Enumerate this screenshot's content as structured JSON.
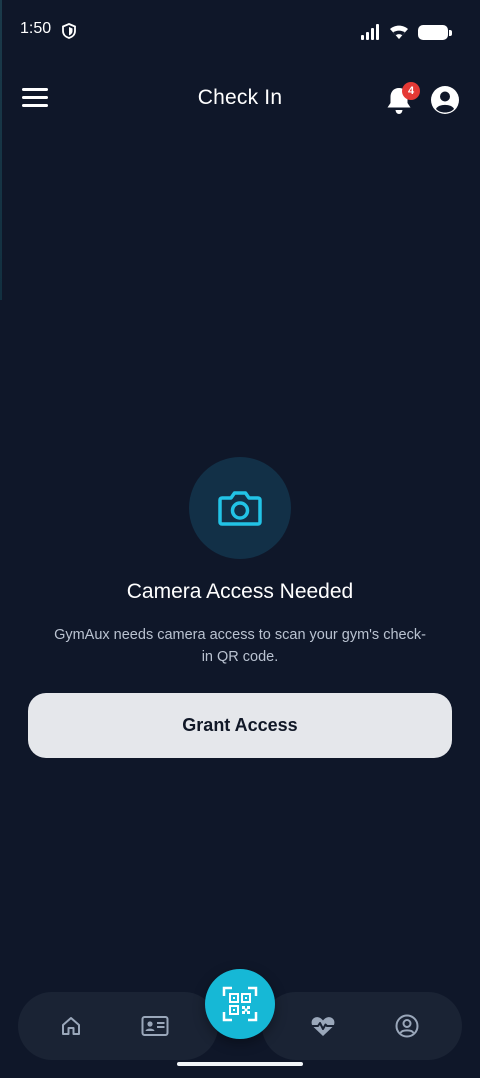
{
  "status_bar": {
    "time": "1:50"
  },
  "app_bar": {
    "title": "Check In",
    "notification_count": "4"
  },
  "content": {
    "title": "Camera Access Needed",
    "description": "GymAux needs camera access to scan your gym's check-in QR code.",
    "grant_button_label": "Grant Access"
  },
  "bottom_nav": {
    "items": [
      {
        "icon": "home-icon"
      },
      {
        "icon": "id-card-icon"
      },
      {
        "icon": "qr-scan-icon"
      },
      {
        "icon": "heart-pulse-icon"
      },
      {
        "icon": "user-circle-icon"
      }
    ]
  },
  "colors": {
    "background": "#0f1729",
    "accent": "#16b8d6",
    "badge": "#e53935",
    "button": "#e5e7eb"
  }
}
